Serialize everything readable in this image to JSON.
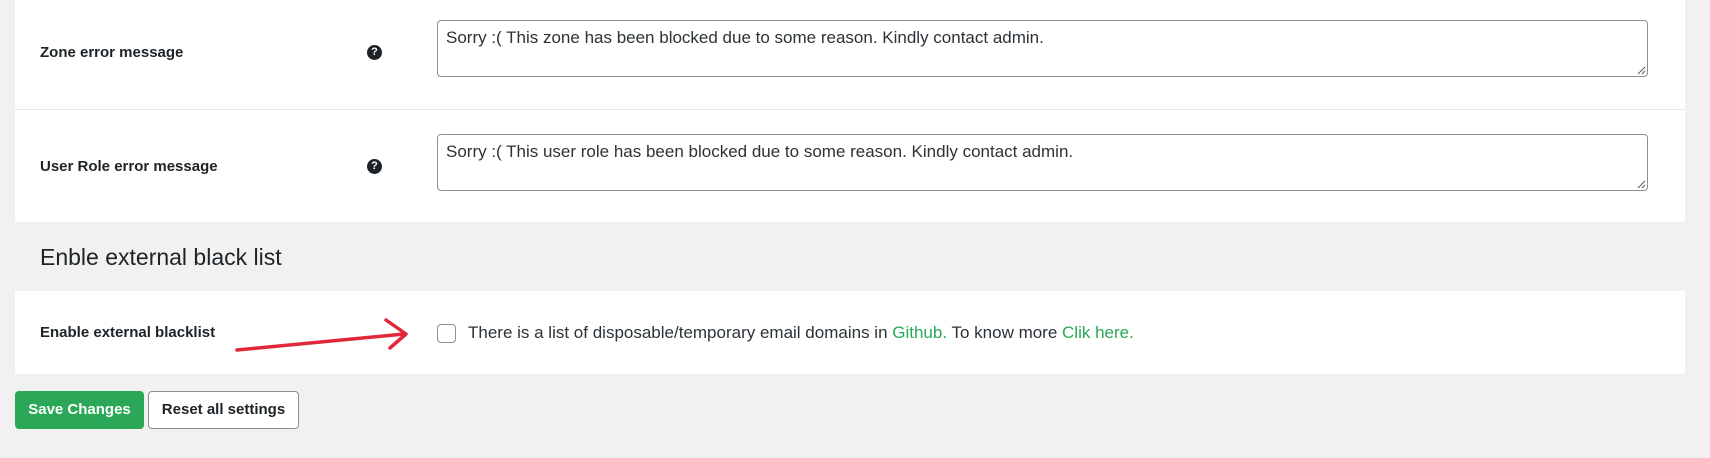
{
  "rows": [
    {
      "label": "Zone error message",
      "value": "Sorry :( This zone has been blocked due to some reason. Kindly contact admin."
    },
    {
      "label": "User Role error message",
      "value": "Sorry :( This user role has been blocked due to some reason. Kindly contact admin."
    }
  ],
  "help_icon_glyph": "?",
  "section_heading": "Enble external black list",
  "external_blacklist": {
    "label": "Enable external blacklist",
    "checked": false,
    "text_before": "There is a list of disposable/temporary email domains in ",
    "github_link": "Github.",
    "text_middle": " To know more ",
    "more_link": "Clik here."
  },
  "buttons": {
    "save": "Save Changes",
    "reset": "Reset all settings"
  },
  "colors": {
    "accent": "#2aa858",
    "annotation_arrow": "#e0283a"
  },
  "icons": [
    "help-icon",
    "resize-grip-icon",
    "annotation-arrow-icon"
  ]
}
